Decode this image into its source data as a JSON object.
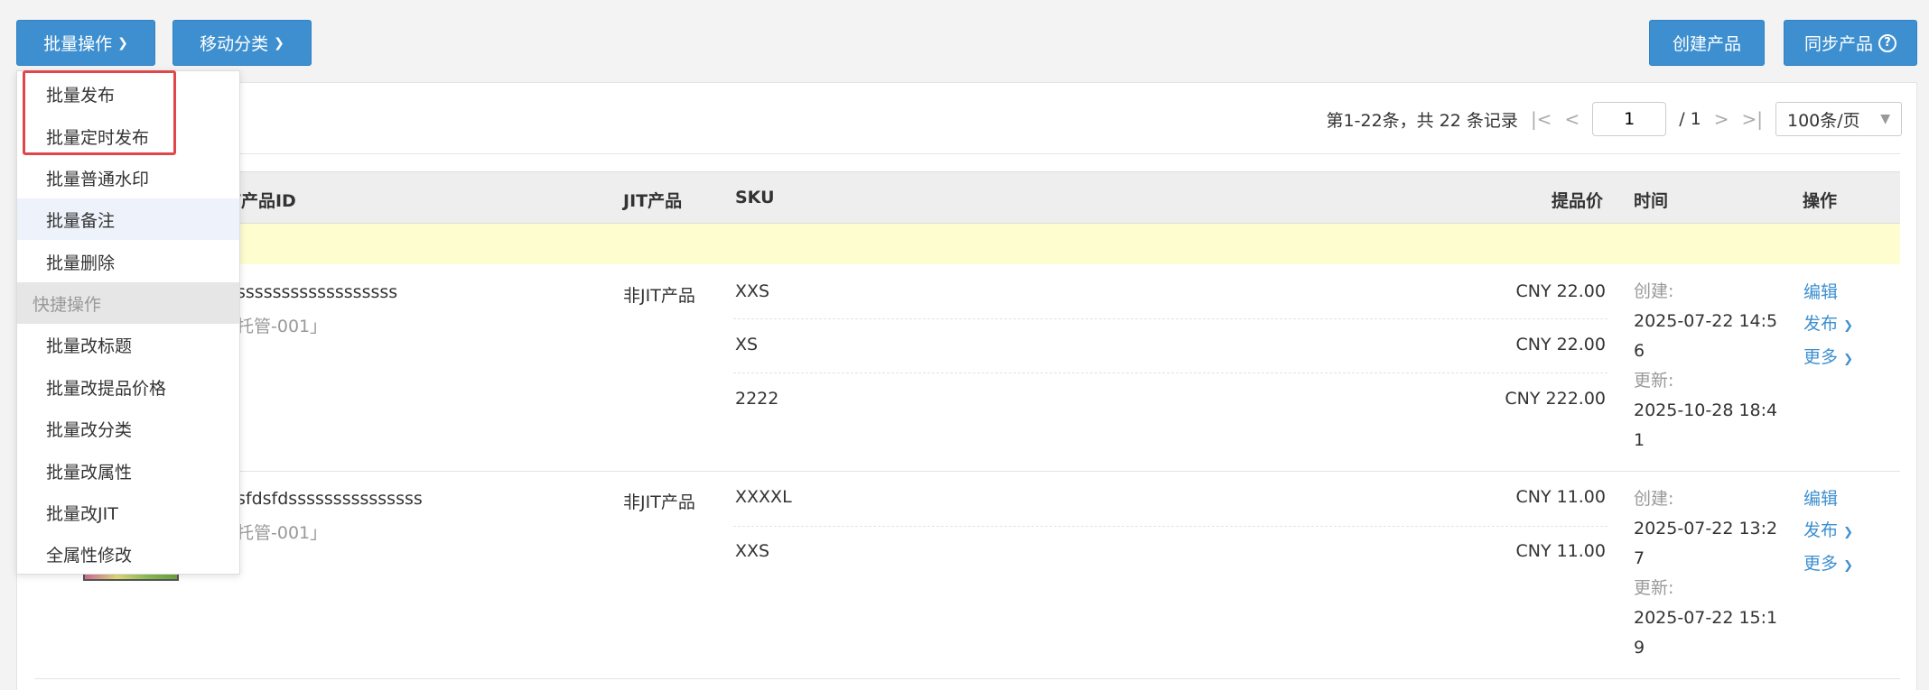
{
  "toolbar": {
    "batch_label": "批量操作",
    "move_label": "移动分类",
    "create_label": "创建产品",
    "sync_label": "同步产品",
    "sync_help": "?"
  },
  "pager": {
    "summary": "第1-22条，共 22 条记录",
    "first": "|<",
    "prev": "<",
    "current_page": "1",
    "total": "/ 1",
    "next": ">",
    "last": ">|",
    "page_size": "100条/页"
  },
  "table": {
    "headers": {
      "product_id": "/产品ID",
      "jit": "JIT产品",
      "sku": "SKU",
      "price": "提品价",
      "time": "时间",
      "ops": "操作"
    },
    "rows": [
      {
        "title": "ssssssssssssssssss",
        "subtitle": "托管-001」",
        "jit": "非JIT产品",
        "skus": [
          {
            "sku": "XXS",
            "price": "CNY 22.00"
          },
          {
            "sku": "XS",
            "price": "CNY 22.00"
          },
          {
            "sku": "2222",
            "price": "CNY 222.00"
          }
        ],
        "created_label": "创建:",
        "created_1": "2025-07-22 14:5",
        "created_2": "6",
        "updated_label": "更新:",
        "updated_1": "2025-10-28 18:4",
        "updated_2": "1",
        "edit": "编辑",
        "publish": "发布",
        "more": "更多"
      },
      {
        "title": "sfdsfdsssssssssssssss",
        "subtitle": "托管-001」",
        "jit": "非JIT产品",
        "skus": [
          {
            "sku": "XXXXL",
            "price": "CNY 11.00"
          },
          {
            "sku": "XXS",
            "price": "CNY 11.00"
          }
        ],
        "created_label": "创建:",
        "created_1": "2025-07-22 13:2",
        "created_2": "7",
        "updated_label": "更新:",
        "updated_1": "2025-07-22 15:1",
        "updated_2": "9",
        "edit": "编辑",
        "publish": "发布",
        "more": "更多"
      }
    ]
  },
  "dropdown": {
    "items": [
      "批量发布",
      "批量定时发布",
      "批量普通水印",
      "批量备注",
      "批量删除"
    ],
    "section_header": "快捷操作",
    "quick_items": [
      "批量改标题",
      "批量改提品价格",
      "批量改分类",
      "批量改属性",
      "批量改JIT",
      "全属性修改"
    ]
  },
  "colors": {
    "accent": "#3d8fd0",
    "highlight": "#e0474c",
    "notice_bg": "#fefdd0"
  }
}
